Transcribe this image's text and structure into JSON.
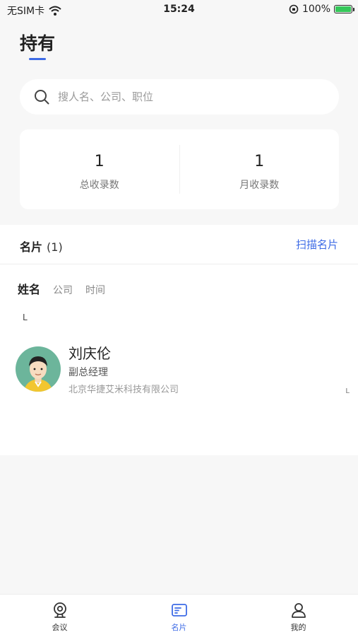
{
  "status_bar": {
    "carrier": "无SIM卡",
    "time": "15:24",
    "battery": "100%"
  },
  "page": {
    "title": "持有"
  },
  "search": {
    "placeholder": "搜人名、公司、职位"
  },
  "stats": [
    {
      "value": "1",
      "label": "总收录数"
    },
    {
      "value": "1",
      "label": "月收录数"
    }
  ],
  "cards": {
    "title": "名片",
    "count": "(1)",
    "scan_label": "扫描名片",
    "sort_tabs": [
      "姓名",
      "公司",
      "时间"
    ],
    "index_letter": "L",
    "side_index": "L",
    "contacts": [
      {
        "name": "刘庆伦",
        "title": "副总经理",
        "company": "北京华捷艾米科技有限公司"
      }
    ]
  },
  "tabbar": {
    "items": [
      {
        "label": "会议",
        "icon": "meeting-icon"
      },
      {
        "label": "名片",
        "icon": "card-icon"
      },
      {
        "label": "我的",
        "icon": "profile-icon"
      }
    ],
    "active_color": "#3d6be6"
  },
  "colors": {
    "accent": "#3d6be6",
    "background": "#f7f7f7",
    "avatar_bg": "#6cb59b"
  }
}
